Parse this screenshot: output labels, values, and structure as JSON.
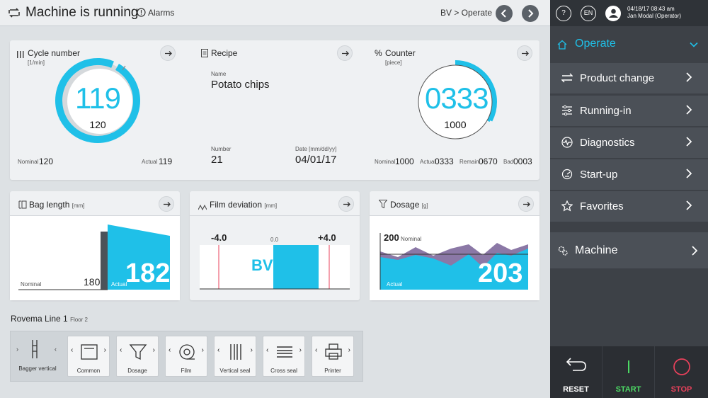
{
  "topbar": {
    "title": "Machine is running",
    "alarms_label": "Alarms",
    "breadcrumb": "BV > Operate"
  },
  "cycle": {
    "title": "Cycle number",
    "unit": "[1/min]",
    "big_value": "119",
    "sub_value": "120",
    "nominal_label": "Nominal",
    "nominal_value": "120",
    "actual_label": "Actual",
    "actual_value": "119"
  },
  "recipe": {
    "title": "Recipe",
    "name_label": "Name",
    "name_value": "Potato chips",
    "number_label": "Number",
    "number_value": "21",
    "date_label": "Date [mm/dd/yy]",
    "date_value": "04/01/17"
  },
  "counter": {
    "title": "Counter",
    "unit": "[piece]",
    "big_value": "0333",
    "sub_value": "1000",
    "nominal_label": "Nominal",
    "nominal_value": "1000",
    "actual_label": "Actual",
    "actual_value": "0333",
    "remain_label": "Remain",
    "remain_value": "0670",
    "bad_label": "Bad",
    "bad_value": "0003",
    "progress": 0.333
  },
  "bag_length": {
    "title": "Bag length",
    "unit": "[mm]",
    "nominal_label": "Nominal",
    "nominal_value": "180",
    "actual_label": "Actual",
    "actual_value": "182"
  },
  "film_deviation": {
    "title": "Film deviation",
    "unit": "[mm]",
    "min": "-4.0",
    "center": "0.0",
    "max": "+4.0",
    "marker": "BV"
  },
  "dosage": {
    "title": "Dosage",
    "unit": "[g]",
    "nominal_value": "200",
    "nominal_label": "Nominal",
    "actual_label": "Actual",
    "actual_value": "203"
  },
  "line": {
    "title": "Rovema Line 1",
    "floor": "Floor 2",
    "modules": [
      "Bagger vertical",
      "Common",
      "Dosage",
      "Film",
      "Vertical seal",
      "Cross seal",
      "Printer"
    ]
  },
  "sidebar": {
    "language": "EN",
    "help": "?",
    "date": "04/18/17 08:43 am",
    "user": "Jan Modal (Operator)",
    "operate_label": "Operate",
    "items": [
      {
        "label": "Product change"
      },
      {
        "label": "Running-in"
      },
      {
        "label": "Diagnostics"
      },
      {
        "label": "Start-up"
      },
      {
        "label": "Favorites"
      }
    ],
    "machine_label": "Machine",
    "reset_label": "RESET",
    "start_label": "START",
    "stop_label": "STOP"
  },
  "colors": {
    "accent": "#1fc0e8",
    "start": "#4cd964",
    "stop": "#e8415b"
  }
}
